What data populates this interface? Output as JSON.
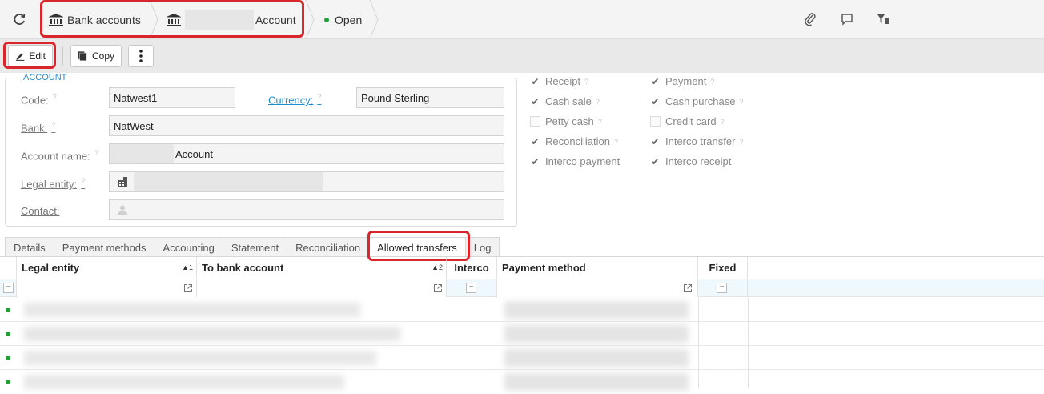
{
  "breadcrumb": {
    "item1": "Bank accounts",
    "item2_suffix": "Account",
    "status": "Open",
    "status_color": "#21a135"
  },
  "toolbar": {
    "edit_label": "Edit",
    "copy_label": "Copy"
  },
  "account": {
    "legend": "ACCOUNT",
    "code_label": "Code:",
    "code_value": "Natwest1",
    "currency_label": "Currency:",
    "currency_value": "Pound Sterling",
    "bank_label": "Bank:",
    "bank_value": "NatWest",
    "account_name_label": "Account name:",
    "account_name_suffix": "Account",
    "legal_entity_label": "Legal entity:",
    "contact_label": "Contact:"
  },
  "options": {
    "left": [
      {
        "label": "Receipt",
        "checked": true
      },
      {
        "label": "Cash sale",
        "checked": true
      },
      {
        "label": "Petty cash",
        "checked": false
      },
      {
        "label": "Reconciliation",
        "checked": true
      },
      {
        "label": "Interco payment",
        "checked": true
      }
    ],
    "right": [
      {
        "label": "Payment",
        "checked": true
      },
      {
        "label": "Cash purchase",
        "checked": true
      },
      {
        "label": "Credit card",
        "checked": false
      },
      {
        "label": "Interco transfer",
        "checked": true
      },
      {
        "label": "Interco receipt",
        "checked": true
      }
    ]
  },
  "tabs": [
    "Details",
    "Payment methods",
    "Accounting",
    "Statement",
    "Reconciliation",
    "Allowed transfers",
    "Log"
  ],
  "active_tab": "Allowed transfers",
  "grid": {
    "columns": {
      "legal_entity": "Legal entity",
      "legal_entity_sort": "▲1",
      "to_bank_account": "To bank account",
      "to_bank_account_sort": "▲2",
      "interco": "Interco",
      "payment_method": "Payment method",
      "fixed": "Fixed"
    }
  },
  "highlight_color": "#d9262c"
}
